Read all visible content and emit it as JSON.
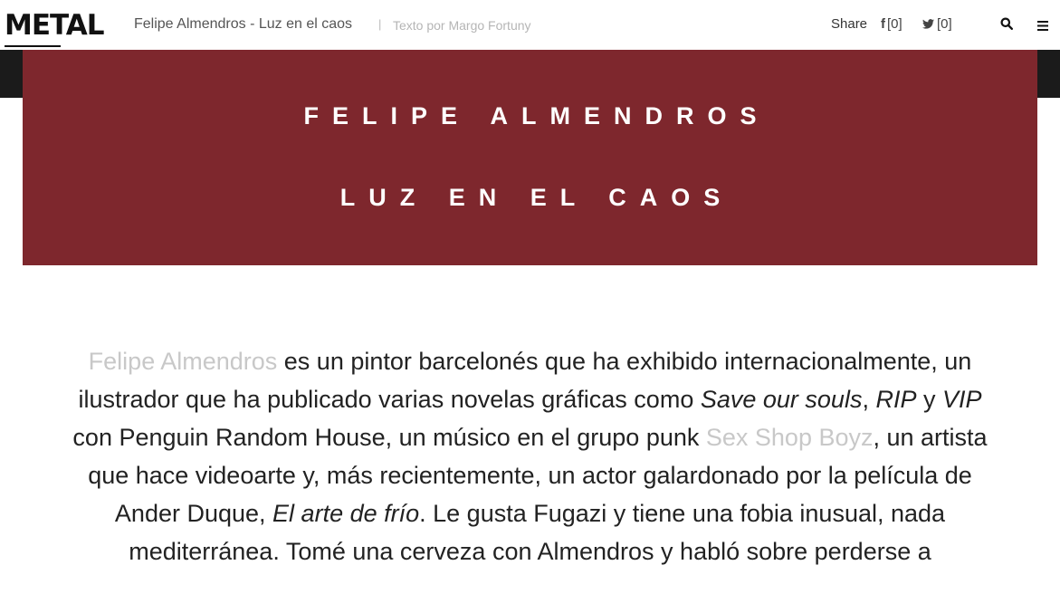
{
  "header": {
    "logo": "METAL",
    "title": "Felipe Almendros - Luz en el caos",
    "separator": "|",
    "author": "Texto por Margo Fortuny",
    "share_label": "Share",
    "facebook_count": "[0]",
    "twitter_count": "[0]",
    "facebook_icon": "f",
    "twitter_icon": "twitter-bird"
  },
  "hero": {
    "line1": "FELIPE ALMENDROS",
    "line2": "LUZ EN EL CAOS",
    "background_color": "#7e272d"
  },
  "article": {
    "link1": "Felipe Almendros",
    "p1": " es un pintor barcelonés que ha exhibido internacionalmente, un ilustrador que ha publicado varias novelas gráficas como ",
    "book1": "Save our souls",
    "p2": ", ",
    "book2": "RIP",
    "p3": " y ",
    "book3": "VIP",
    "p4": " con Penguin Random House, un músico en el grupo punk ",
    "link2": "Sex Shop Boyz",
    "p5": ", un artista que hace videoarte y, más recientemente, un actor galardonado por la película de Ander Duque, ",
    "film": "El arte de frío",
    "p6": ". Le gusta Fugazi y tiene una fobia inusual, nada mediterránea. Tomé una cerveza con Almendros y habló sobre perderse a"
  },
  "colors": {
    "link": "#c8c8c8",
    "text": "#222222",
    "dark_band": "#1b1b1b"
  }
}
